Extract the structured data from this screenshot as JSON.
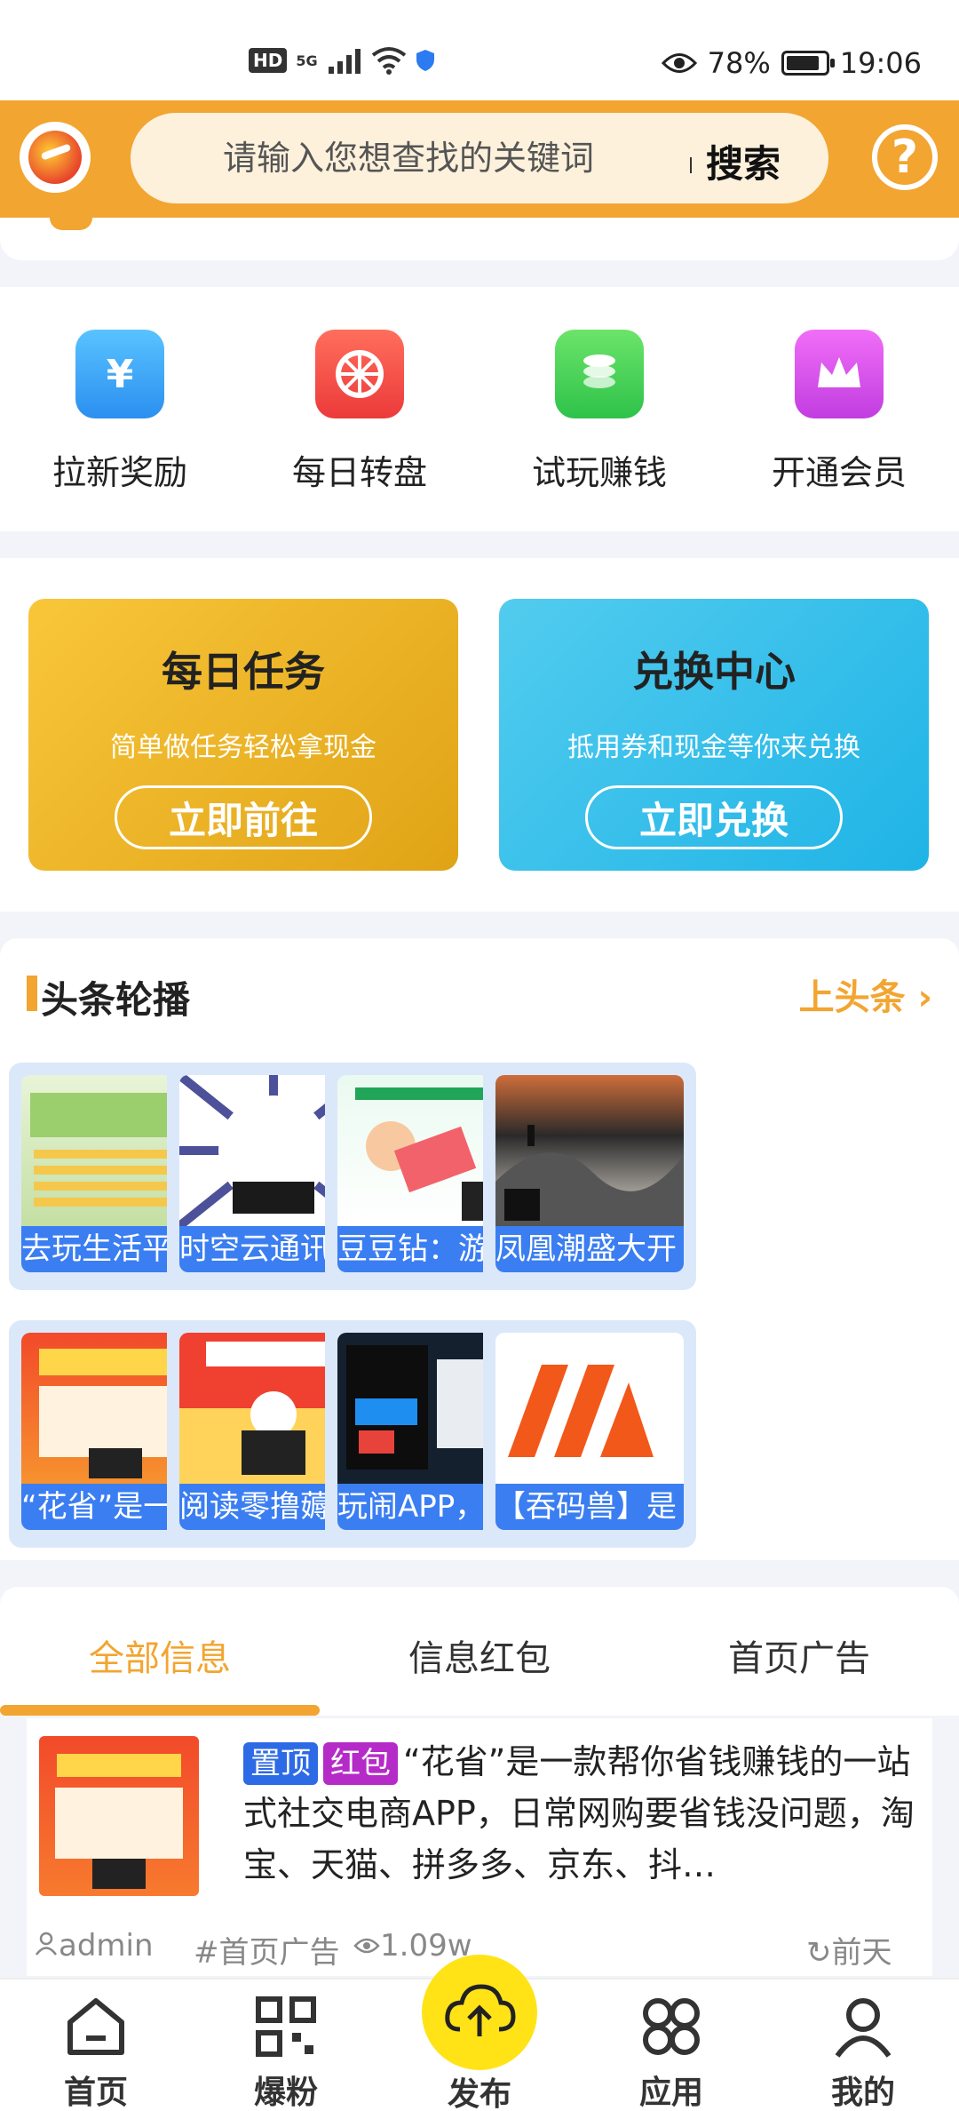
{
  "status_bar": {
    "hd": "HD",
    "network": "5G",
    "battery": "78%",
    "time": "19:06"
  },
  "search": {
    "placeholder": "请输入您想查找的关键词",
    "button": "搜索"
  },
  "quick_links": [
    {
      "label": "拉新奖励",
      "color": "#3aa7f5",
      "icon": "money-bag-icon"
    },
    {
      "label": "每日转盘",
      "color": "#f2504a",
      "icon": "wheel-icon"
    },
    {
      "label": "试玩赚钱",
      "color": "#3fcf4f",
      "icon": "coins-icon"
    },
    {
      "label": "开通会员",
      "color": "#d24be8",
      "icon": "crown-icon"
    }
  ],
  "cards": {
    "task": {
      "title": "每日任务",
      "subtitle": "简单做任务轻松拿现金",
      "button": "立即前往"
    },
    "exchange": {
      "title": "兑换中心",
      "subtitle": "抵用券和现金等你来兑换",
      "button": "立即兑换"
    }
  },
  "headline": {
    "title": "头条轮播",
    "more": "上头条",
    "items": [
      {
        "caption": "去玩生活平台"
      },
      {
        "caption": "时空云通讯联"
      },
      {
        "caption": "豆豆钻：游戏"
      },
      {
        "caption": "凤凰潮盛大开"
      },
      {
        "caption": "“花省”是一款"
      },
      {
        "caption": "阅读零撸薅羊"
      },
      {
        "caption": "玩闹APP，您"
      },
      {
        "caption": "【吞码兽】是"
      }
    ]
  },
  "tabs": [
    {
      "label": "全部信息"
    },
    {
      "label": "信息红包"
    },
    {
      "label": "首页广告"
    }
  ],
  "post": {
    "badge_top": "置顶",
    "badge_red": "红包",
    "text": "“花省”是一款帮你省钱赚钱的一站式社交电商APP，日常网购要省钱没问题，淘宝、天猫、拼多多、京东、抖…",
    "author": "admin",
    "category": "首页广告",
    "views": "1.09w",
    "time": "前天"
  },
  "bottom_nav": [
    {
      "label": "首页"
    },
    {
      "label": "爆粉"
    },
    {
      "label": "发布"
    },
    {
      "label": "应用"
    },
    {
      "label": "我的"
    }
  ]
}
